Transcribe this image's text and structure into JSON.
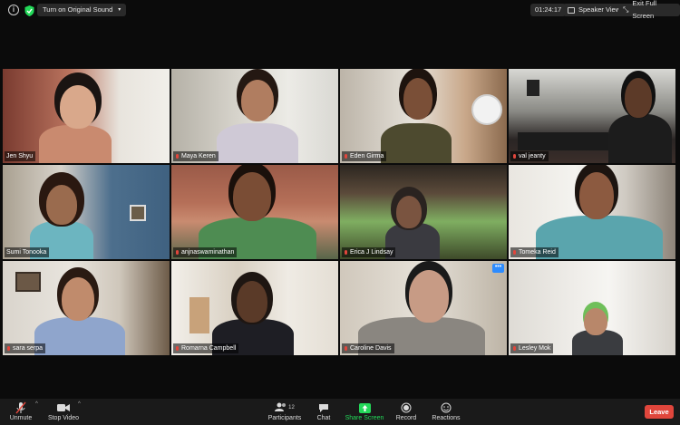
{
  "topbar": {
    "sound_label": "Turn on Original Sound",
    "timer": "01:24:17",
    "speaker_view_label": "Speaker View",
    "exit_fullscreen_label": "Exit Full Screen"
  },
  "participants": [
    {
      "name": "Jen Shyu",
      "muted": false
    },
    {
      "name": "Maya Keren",
      "muted": true
    },
    {
      "name": "Eden Girma",
      "muted": true
    },
    {
      "name": "val jeanty",
      "muted": true,
      "active_speaker": true
    },
    {
      "name": "Sumi Tonooka",
      "muted": true
    },
    {
      "name": "anjnaswaminathan",
      "muted": true
    },
    {
      "name": "Erica J Lindsay",
      "muted": true
    },
    {
      "name": "Tomeka Reid",
      "muted": true
    },
    {
      "name": "sara serpa",
      "muted": true
    },
    {
      "name": "Romarna Campbell",
      "muted": true
    },
    {
      "name": "Caroline Davis",
      "muted": true
    },
    {
      "name": "Lesley Mok",
      "muted": true
    }
  ],
  "tile_more_label": "•••",
  "controls": {
    "unmute": "Unmute",
    "stop_video": "Stop Video",
    "participants": "Participants",
    "participants_count": "12",
    "chat": "Chat",
    "share_screen": "Share Screen",
    "record": "Record",
    "reactions": "Reactions",
    "leave": "Leave"
  },
  "colors": {
    "accent": "#2d8cff",
    "share_green": "#23d959",
    "leave_red": "#e0463c",
    "active_border": "#d6e06a"
  }
}
